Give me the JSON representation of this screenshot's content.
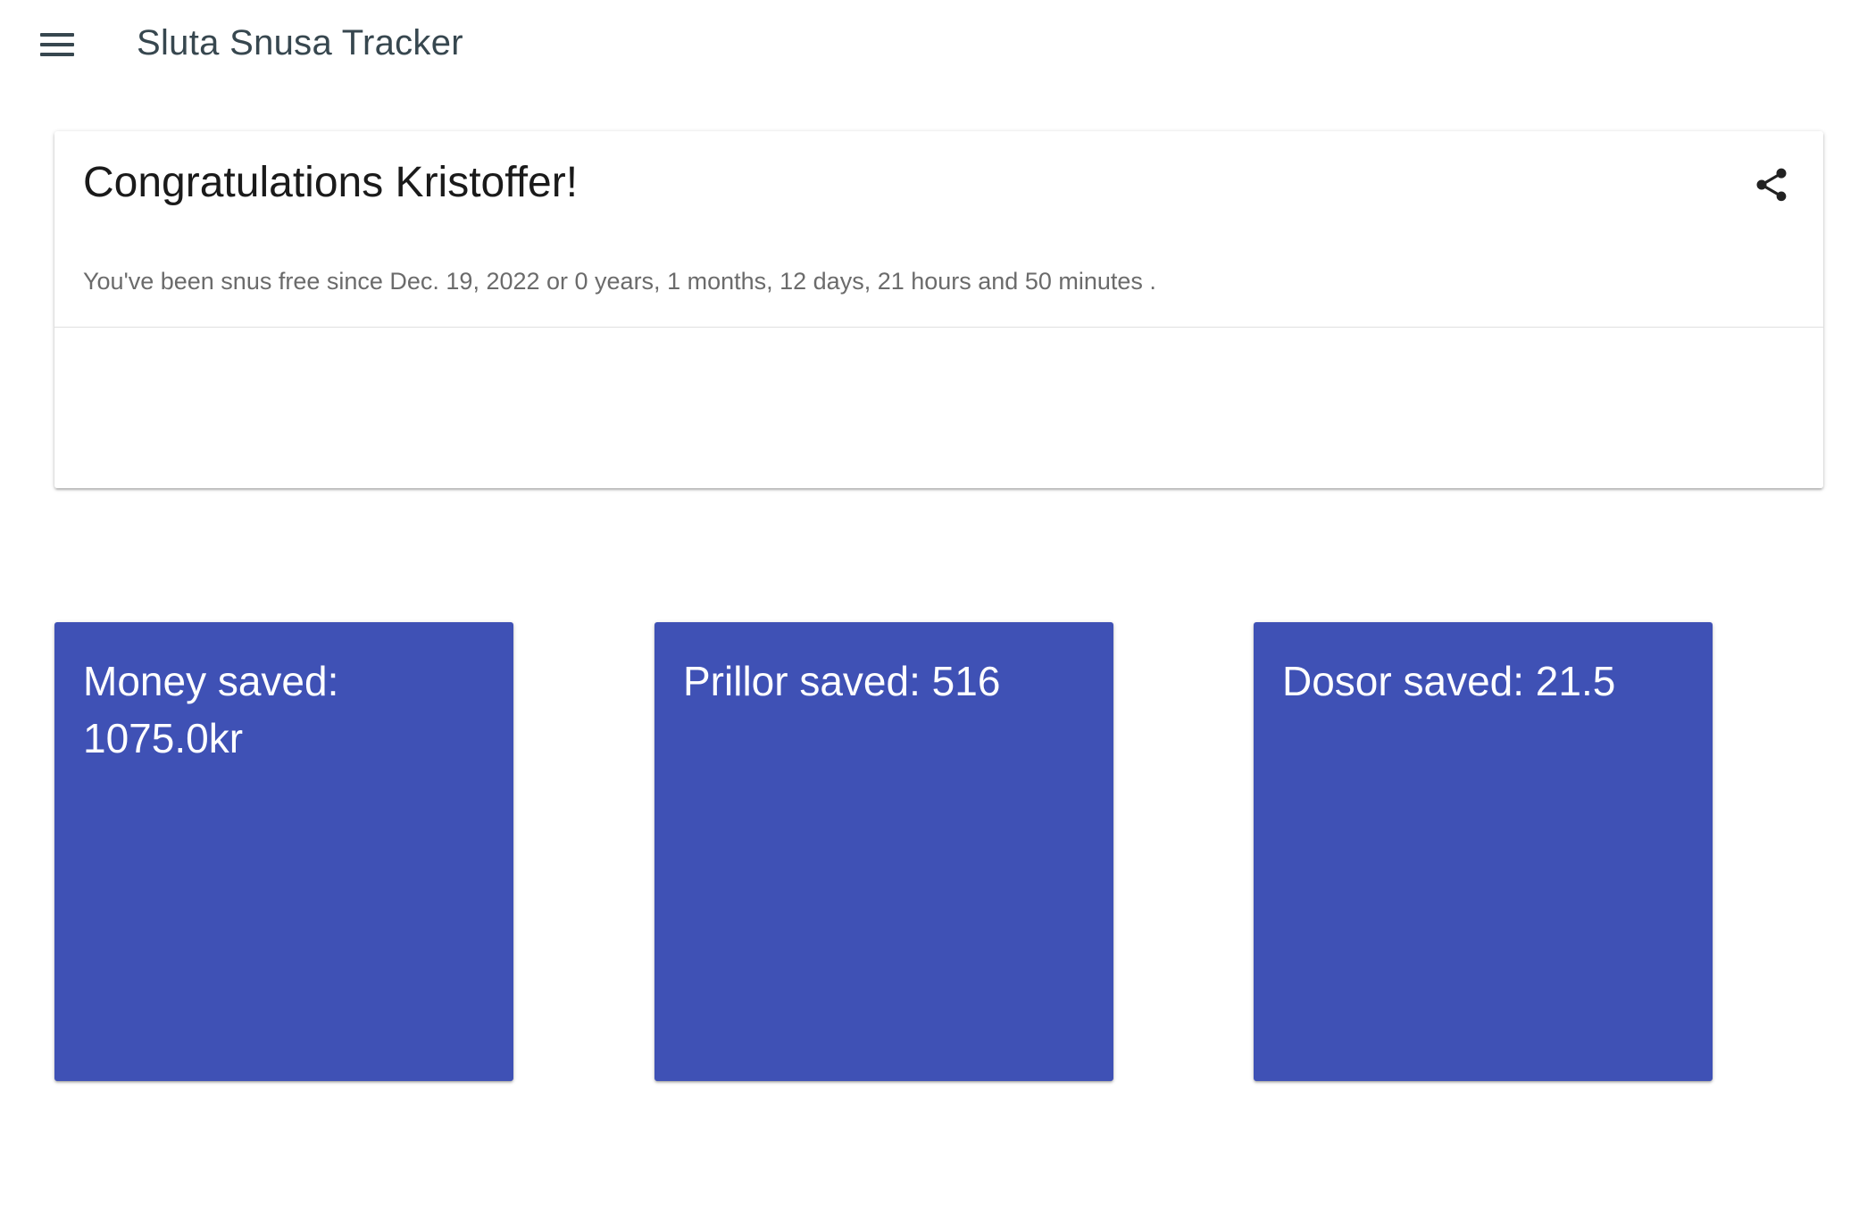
{
  "app": {
    "title": "Sluta Snusa Tracker"
  },
  "hero": {
    "title": "Congratulations Kristoffer!",
    "status_text": "You've been snus free since Dec. 19, 2022 or 0 years, 1 months, 12 days, 21 hours and 50 minutes ."
  },
  "stats": [
    {
      "label": "Money saved: 1075.0kr"
    },
    {
      "label": "Prillor saved: 516"
    },
    {
      "label": "Dosor saved: 21.5"
    }
  ],
  "icons": {
    "menu": "menu-icon",
    "share": "share-icon"
  },
  "colors": {
    "accent": "#3f51b5",
    "app_title": "#37474f",
    "muted_text": "#6b6b6b"
  }
}
